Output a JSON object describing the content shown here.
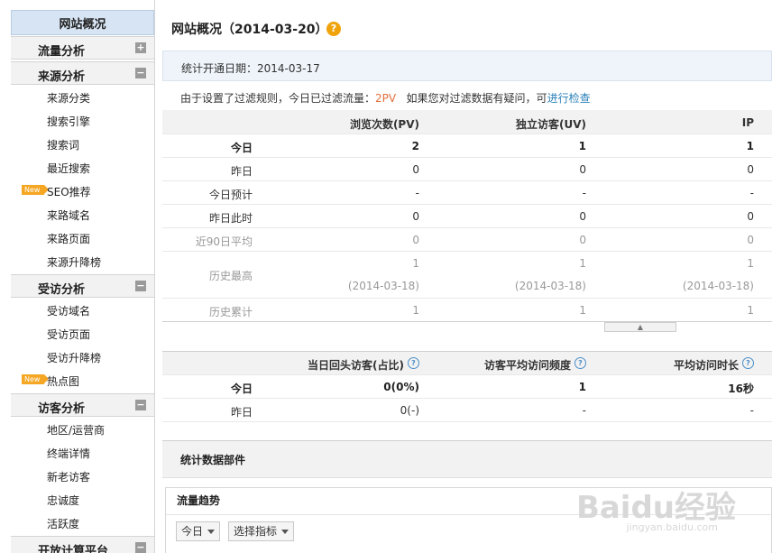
{
  "sidebar": {
    "top": "网站概况",
    "sections": [
      {
        "label": "流量分析",
        "toggle": "+",
        "items": []
      },
      {
        "label": "来源分析",
        "toggle": "−",
        "items": [
          "来源分类",
          "搜索引擎",
          "搜索词",
          "最近搜索",
          "SEO推荐",
          "来路域名",
          "来路页面",
          "来源升降榜"
        ]
      },
      {
        "label": "受访分析",
        "toggle": "−",
        "items": [
          "受访域名",
          "受访页面",
          "受访升降榜",
          "热点图"
        ]
      },
      {
        "label": "访客分析",
        "toggle": "−",
        "items": [
          "地区/运营商",
          "终端详情",
          "新老访客",
          "忠诚度",
          "活跃度"
        ]
      },
      {
        "label": "开放计算平台",
        "toggle": "−",
        "items": []
      }
    ],
    "new_tag": "New"
  },
  "main": {
    "title": "网站概况（2014-03-20）",
    "help": "?",
    "open_date": "统计开通日期：2014-03-17",
    "filter_prefix": "由于设置了过滤规则，今日已过滤流量：",
    "filter_value": "2PV",
    "filter_mid": "   如果您对过滤数据有疑问，可",
    "filter_link": "进行检查",
    "table1": {
      "headers": [
        "",
        "浏览次数(PV)",
        "独立访客(UV)",
        "IP"
      ],
      "rows": [
        {
          "label": "今日",
          "pv": "2",
          "uv": "1",
          "ip": "1"
        },
        {
          "label": "昨日",
          "pv": "0",
          "uv": "0",
          "ip": "0"
        },
        {
          "label": "今日预计",
          "pv": "-",
          "uv": "-",
          "ip": "-"
        },
        {
          "label": "昨日此时",
          "pv": "0",
          "uv": "0",
          "ip": "0"
        },
        {
          "label": "近90日平均",
          "pv": "0",
          "uv": "0",
          "ip": "0"
        },
        {
          "label": "历史最高",
          "pv": "1",
          "uv": "1",
          "ip": "1",
          "pv_date": "(2014-03-18)",
          "uv_date": "(2014-03-18)",
          "ip_date": "(2014-03-18)"
        },
        {
          "label": "历史累计",
          "pv": "1",
          "uv": "1",
          "ip": "1"
        }
      ]
    },
    "collapse": "▲",
    "table2": {
      "headers": [
        "",
        "当日回头访客(占比)",
        "访客平均访问频度",
        "平均访问时长"
      ],
      "rows": [
        {
          "label": "今日",
          "a": "0(0%)",
          "b": "1",
          "c": "16秒"
        },
        {
          "label": "昨日",
          "a": "0(-)",
          "b": "-",
          "c": "-"
        }
      ]
    },
    "widgets_title": "统计数据部件",
    "trend_title": "流量趋势",
    "dropdown_day": "今日",
    "dropdown_metric": "选择指标"
  },
  "watermark": "Baidu经验",
  "watermark_url": "jingyan.baidu.com"
}
